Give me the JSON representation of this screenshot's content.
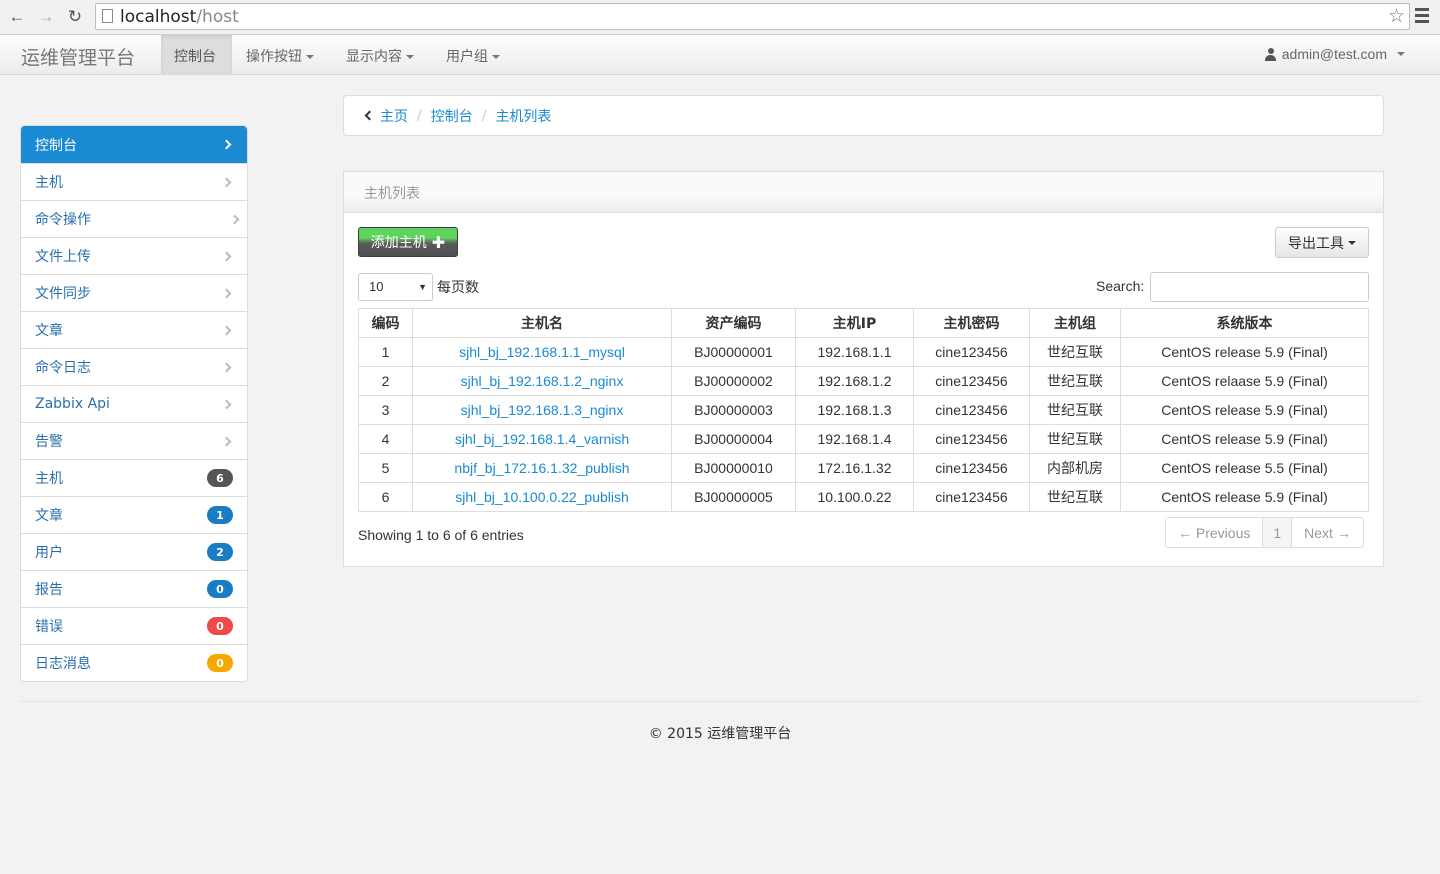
{
  "browser": {
    "url_host": "localhost",
    "url_path": "/host"
  },
  "navbar": {
    "brand": "运维管理平台",
    "items": [
      {
        "label": "控制台"
      },
      {
        "label": "操作按钮"
      },
      {
        "label": "显示内容"
      },
      {
        "label": "用户组"
      }
    ],
    "user": "admin@test.com"
  },
  "sidebar": {
    "items": [
      {
        "label": "控制台"
      },
      {
        "label": "主机"
      },
      {
        "label": "命令操作"
      },
      {
        "label": "文件上传"
      },
      {
        "label": "文件同步"
      },
      {
        "label": "文章"
      },
      {
        "label": "命令日志"
      },
      {
        "label": "Zabbix Api"
      },
      {
        "label": "告警"
      },
      {
        "label": "主机",
        "badge": "6",
        "badge_color": "#555555"
      },
      {
        "label": "文章",
        "badge": "1",
        "badge_color": "#1a7dc4"
      },
      {
        "label": "用户",
        "badge": "2",
        "badge_color": "#1a7dc4"
      },
      {
        "label": "报告",
        "badge": "0",
        "badge_color": "#1a7dc4"
      },
      {
        "label": "错误",
        "badge": "0",
        "badge_color": "#ef4a4a"
      },
      {
        "label": "日志消息",
        "badge": "0",
        "badge_color": "#f5a800"
      }
    ]
  },
  "breadcrumb": [
    "主页",
    "控制台",
    "主机列表"
  ],
  "panel": {
    "title": "主机列表",
    "add_button": "添加主机",
    "export_button": "导出工具",
    "page_size": "10",
    "page_size_label": "每页数",
    "search_label": "Search:",
    "columns": [
      "编码",
      "主机名",
      "资产编码",
      "主机IP",
      "主机密码",
      "主机组",
      "系统版本"
    ],
    "rows": [
      [
        "1",
        "sjhl_bj_192.168.1.1_mysql",
        "BJ00000001",
        "192.168.1.1",
        "cine123456",
        "世纪互联",
        "CentOS release 5.9 (Final)"
      ],
      [
        "2",
        "sjhl_bj_192.168.1.2_nginx",
        "BJ00000002",
        "192.168.1.2",
        "cine123456",
        "世纪互联",
        "CentOS relaase 5.9 (Final)"
      ],
      [
        "3",
        "sjhl_bj_192.168.1.3_nginx",
        "BJ00000003",
        "192.168.1.3",
        "cine123456",
        "世纪互联",
        "CentOS release 5.9 (Final)"
      ],
      [
        "4",
        "sjhl_bj_192.168.1.4_varnish",
        "BJ00000004",
        "192.168.1.4",
        "cine123456",
        "世纪互联",
        "CentOS release 5.9 (Final)"
      ],
      [
        "5",
        "nbjf_bj_172.16.1.32_publish",
        "BJ00000010",
        "172.16.1.32",
        "cine123456",
        "内部机房",
        "CentOS release 5.5 (Final)"
      ],
      [
        "6",
        "sjhl_bj_10.100.0.22_publish",
        "BJ00000005",
        "10.100.0.22",
        "cine123456",
        "世纪互联",
        "CentOS release 5.9 (Final)"
      ]
    ],
    "showing": "Showing 1 to 6 of 6 entries",
    "pager": {
      "prev": "← Previous",
      "page": "1",
      "next": "Next →"
    }
  },
  "footer": "© 2015 运维管理平台"
}
